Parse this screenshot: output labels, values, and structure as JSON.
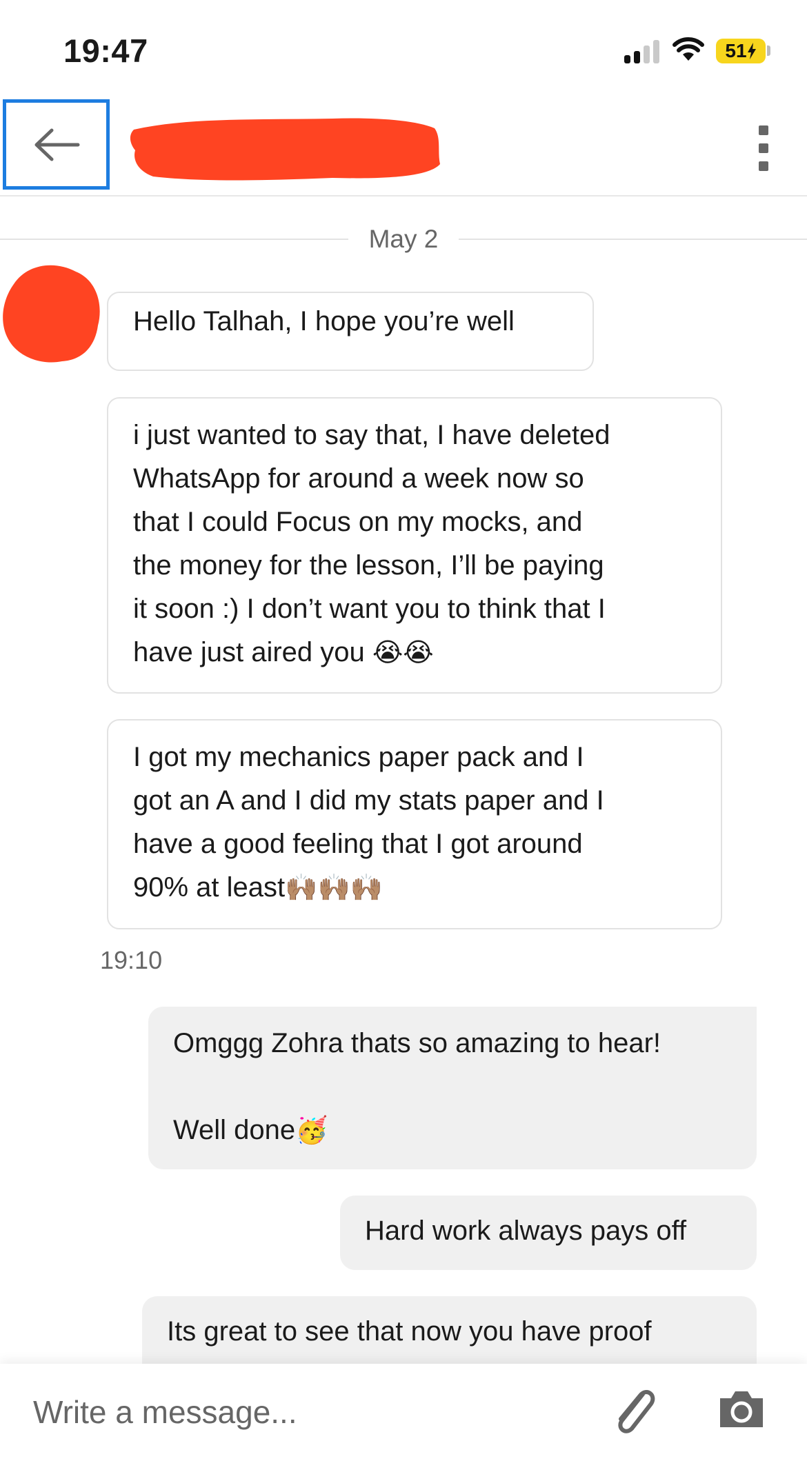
{
  "status_bar": {
    "time": "19:47",
    "battery": "51",
    "battery_charging": true
  },
  "header": {
    "back_icon": "arrow-left-icon",
    "contact_name_redacted": true,
    "more_icon": "more-vertical-icon"
  },
  "conversation": {
    "date_divider": "May 2",
    "messages": [
      {
        "direction": "incoming",
        "lines": [
          "Hello Talhah, I hope you’re well"
        ]
      },
      {
        "direction": "incoming",
        "lines": [
          "i just wanted to say that, I have deleted",
          "WhatsApp for around a week now so",
          "that I could Focus on my mocks, and",
          "the money for the lesson, I’ll be paying",
          "it soon :) I don’t want you to think that I",
          "have just aired you"
        ],
        "emojis": "😭😭"
      },
      {
        "direction": "incoming",
        "lines": [
          "I got my mechanics paper pack and I",
          "got an A and I did my stats paper and I",
          "have a good feeling that I got around",
          "90% at least"
        ],
        "emojis": "🙌🏽🙌🏽🙌🏽"
      },
      {
        "timestamp": "19:10"
      },
      {
        "direction": "outgoing",
        "lines": [
          "Omggg Zohra thats so amazing to hear!",
          "",
          "Well done"
        ],
        "emojis": "🥳"
      },
      {
        "direction": "outgoing",
        "lines": [
          "Hard work always pays off"
        ]
      },
      {
        "direction": "outgoing",
        "lines": [
          "Its great to see that now you have proof"
        ]
      }
    ]
  },
  "composer": {
    "placeholder": "Write a message...",
    "attach_icon": "paperclip-icon",
    "camera_icon": "camera-icon"
  },
  "colors": {
    "accent_focus_border": "#1d7de0",
    "redaction": "#ff4422",
    "battery": "#f7d51d",
    "outgoing_bubble": "#f0f0f0"
  }
}
